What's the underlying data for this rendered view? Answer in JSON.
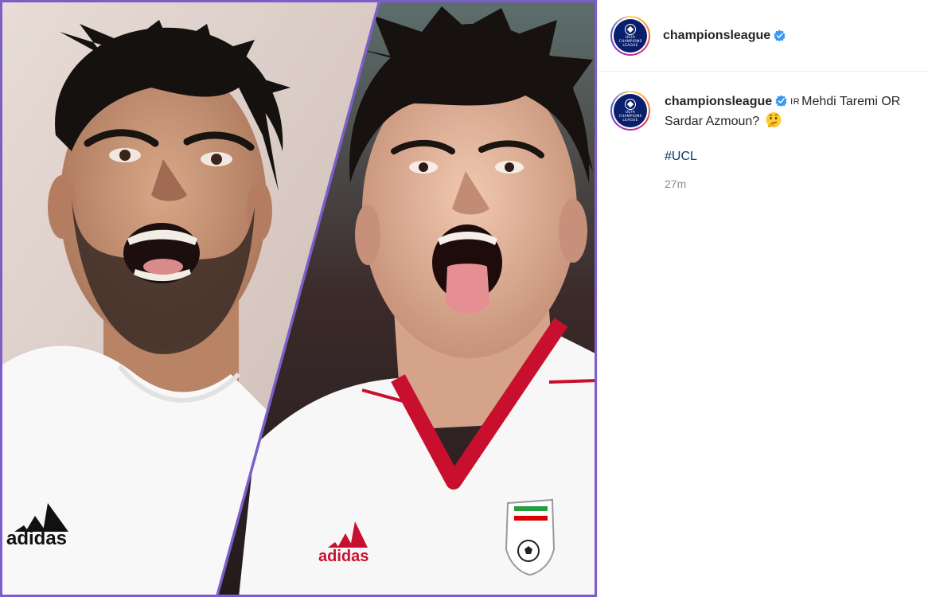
{
  "post": {
    "account": "championsleague",
    "avatar_logo_text": "UEFA CHAMPIONS LEAGUE",
    "caption": {
      "flag_code": "IR",
      "text": "Mehdi Taremi OR Sardar Azmoun?",
      "emoji": "thinking-face",
      "hashtag": "#UCL"
    },
    "time_ago": "27m"
  },
  "media": {
    "divider_color": "#7b5ec9",
    "left_player": {
      "shirt_brand": "adidas",
      "shirt_color": "#ffffff"
    },
    "right_player": {
      "shirt_brand": "adidas",
      "shirt_color": "#ffffff",
      "collar_color": "#c8102e"
    }
  },
  "colors": {
    "verified": "#3897f0",
    "hashtag": "#00376b",
    "timestamp": "#8e8e8e",
    "avatar_bg": "#0a1f6b"
  }
}
